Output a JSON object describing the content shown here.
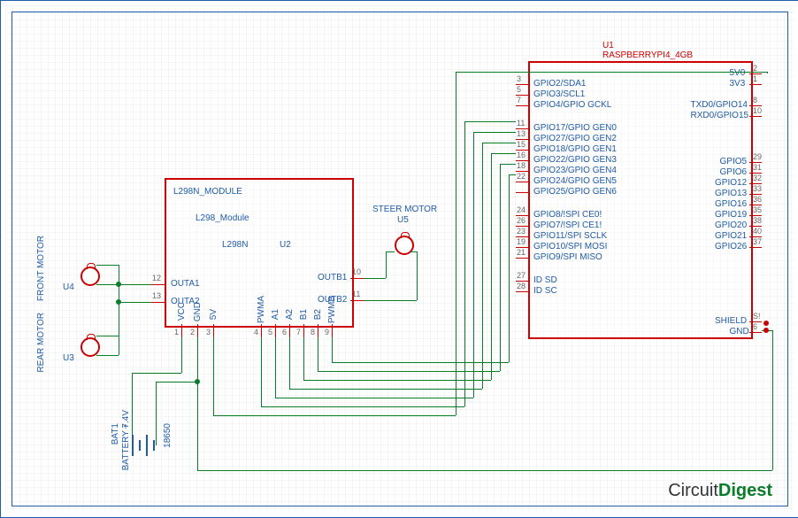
{
  "components": {
    "u1": {
      "ref": "U1",
      "name": "RASPBERRYPI4_4GB"
    },
    "u2": {
      "ref": "U2",
      "name": "L298N_MODULE",
      "sub1": "L298_Module",
      "sub2": "L298N"
    },
    "u3": {
      "ref": "U3"
    },
    "u4": {
      "ref": "U4"
    },
    "u5": {
      "ref": "U5",
      "name": "STEER MOTOR"
    },
    "bat1": {
      "ref": "BAT1",
      "name": "BATTERY 7.4V",
      "type": "18650"
    }
  },
  "side_labels": {
    "front_motor": "FRONT MOTOR",
    "rear_motor": "REAR MOTOR"
  },
  "l298_pins": {
    "outa1": "OUTA1",
    "outa2": "OUTA2",
    "outb1": "OUTB1",
    "outb2": "OUTB2",
    "vcc": "VCC",
    "gnd": "GND",
    "fivev": "5V",
    "pwma": "PWMA",
    "a1": "A1",
    "a2": "A2",
    "b1": "B1",
    "b2": "B2",
    "pwmb": "PWMB"
  },
  "l298_nums": {
    "outa1": "12",
    "outa2": "13",
    "outb1": "10",
    "outb2": "11",
    "vcc": "1",
    "gnd": "2",
    "fivev": "3",
    "pwma": "4",
    "a1": "5",
    "a2": "6",
    "b1": "7",
    "b2": "8",
    "pwmb": "9"
  },
  "pi_left_pins": [
    {
      "num": "3",
      "name": "GPIO2/SDA1"
    },
    {
      "num": "5",
      "name": "GPIO3/SCL1"
    },
    {
      "num": "7",
      "name": "GPIO4/GPIO GCKL"
    },
    {
      "num": "11",
      "name": "GPIO17/GPIO GEN0"
    },
    {
      "num": "13",
      "name": "GPIO27/GPIO GEN2"
    },
    {
      "num": "15",
      "name": "GPIO18/GPIO GEN1"
    },
    {
      "num": "16",
      "name": "GPIO22/GPIO GEN3"
    },
    {
      "num": "18",
      "name": "GPIO23/GPIO GEN4"
    },
    {
      "num": "22",
      "name": "GPIO24/GPIO GEN5"
    },
    {
      "num": "",
      "name": "GPIO25/GPIO GEN6"
    },
    {
      "num": "24",
      "name": "GPIO8/!SPI CE0!"
    },
    {
      "num": "26",
      "name": "GPIO7/!SPI CE1!"
    },
    {
      "num": "23",
      "name": "GPIO11/SPI SCLK"
    },
    {
      "num": "19",
      "name": "GPIO10/SPI MOSI"
    },
    {
      "num": "21",
      "name": "GPIO9/SPI MISO"
    },
    {
      "num": "27",
      "name": "ID SD"
    },
    {
      "num": "28",
      "name": "ID SC"
    }
  ],
  "pi_right_pins": [
    {
      "num": "2",
      "name": "5V0"
    },
    {
      "num": "1",
      "name": "3V3"
    },
    {
      "num": "8",
      "name": "TXD0/GPIO14"
    },
    {
      "num": "10",
      "name": "RXD0/GPIO15"
    },
    {
      "num": "29",
      "name": "GPIO5"
    },
    {
      "num": "31",
      "name": "GPIO6"
    },
    {
      "num": "32",
      "name": "GPIO12"
    },
    {
      "num": "33",
      "name": "GPIO13"
    },
    {
      "num": "36",
      "name": "GPIO16"
    },
    {
      "num": "35",
      "name": "GPIO19"
    },
    {
      "num": "38",
      "name": "GPIO20"
    },
    {
      "num": "40",
      "name": "GPIO21"
    },
    {
      "num": "37",
      "name": "GPIO26"
    },
    {
      "num": "S!",
      "name": "SHIELD"
    },
    {
      "num": "6",
      "name": "GND"
    }
  ],
  "logo": {
    "text1": "Circuit",
    "text2": "Digest"
  }
}
